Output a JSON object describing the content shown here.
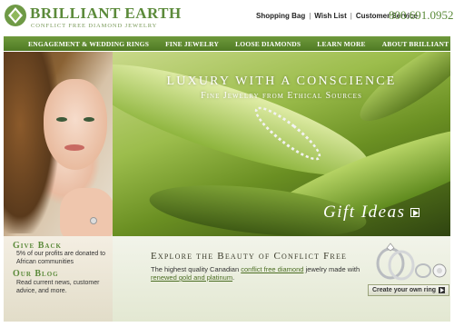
{
  "header": {
    "logo_name": "BRILLIANT EARTH",
    "logo_tagline": "CONFLICT FREE DIAMOND JEWELRY",
    "links": [
      "Shopping Bag",
      "Wish List",
      "Customer Service"
    ],
    "phone": "800.691.0952"
  },
  "nav": {
    "items": [
      "ENGAGEMENT & WEDDING RINGS",
      "FINE JEWELRY",
      "LOOSE DIAMONDS",
      "LEARN MORE",
      "ABOUT BRILLIANT EARTH"
    ]
  },
  "hero": {
    "title": "LUXURY WITH A CONSCIENCE",
    "subtitle": "Fine Jewelry from Ethical Sources",
    "cta": "Gift Ideas"
  },
  "sidebar": {
    "giveback_title": "Give Back",
    "giveback_text": "5% of our profits are donated to African communities",
    "blog_title": "Our Blog",
    "blog_text": "Read current news, customer advice, and more."
  },
  "promo": {
    "title": "Explore the Beauty of Conflict Free",
    "text_1": "The highest quality Canadian ",
    "link_1": "conflict free diamond",
    "text_2": " jewelry made with ",
    "link_2": "renewed gold and platinum",
    "text_3": ".",
    "button": "Create your own ring"
  },
  "colors": {
    "brand_green": "#5b8a3a",
    "nav_green": "#5f8a2e"
  },
  "icons": [
    "diamond-logo-icon",
    "play-arrow-icon",
    "rings-icon"
  ]
}
